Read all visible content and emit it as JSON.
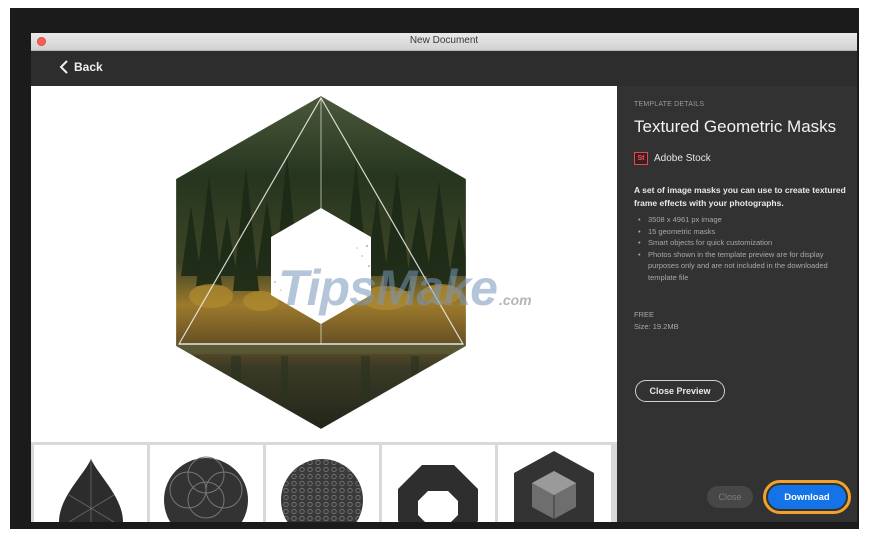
{
  "window": {
    "title": "New Document"
  },
  "toolbar": {
    "back_label": "Back"
  },
  "preview": {
    "watermark_text": "TipsMake",
    "watermark_suffix": ".com"
  },
  "thumbnails": [
    {
      "shape": "teardrop"
    },
    {
      "shape": "circle-floral"
    },
    {
      "shape": "circle-hex"
    },
    {
      "shape": "octagon-ring"
    },
    {
      "shape": "hexagon-cube"
    }
  ],
  "details": {
    "eyebrow": "TEMPLATE DETAILS",
    "title": "Textured Geometric Masks",
    "source_icon_text": "St",
    "source": "Adobe Stock",
    "description": "A set of image masks you can use to create textured frame effects with your photographs.",
    "bullets": [
      "3508 x 4961 px image",
      "15 geometric masks",
      "Smart objects for quick customization",
      "Photos shown in the template preview are for display purposes only and are not included in the downloaded template file"
    ],
    "price": "FREE",
    "size": "Size: 19.2MB",
    "close_preview_label": "Close Preview"
  },
  "footer": {
    "close_label": "Close",
    "download_label": "Download"
  },
  "colors": {
    "accent": "#1473e6",
    "highlight_ring": "#f2a12b",
    "panel_bg": "#323232",
    "stock_red": "#e34850"
  }
}
